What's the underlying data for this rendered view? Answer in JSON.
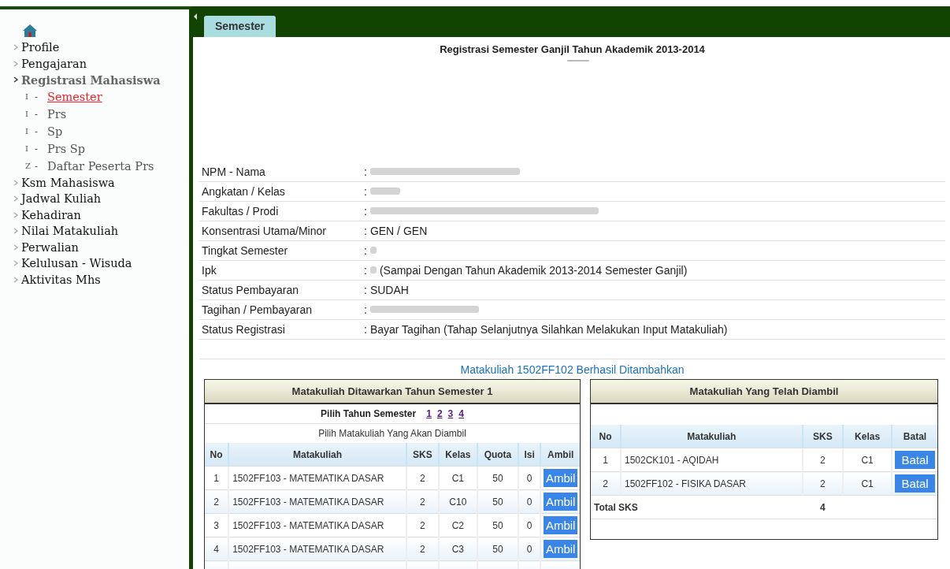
{
  "sidebar": {
    "items": [
      {
        "label": "Profile",
        "expanded": false
      },
      {
        "label": "Pengajaran",
        "expanded": false
      },
      {
        "label": "Registrasi Mahasiswa",
        "expanded": true,
        "children": [
          {
            "prefix": "I",
            "dash": "-",
            "label": "Semester",
            "selected": true
          },
          {
            "prefix": "I",
            "dash": "-",
            "label": "Prs",
            "selected": false
          },
          {
            "prefix": "I",
            "dash": "-",
            "label": "Sp",
            "selected": false
          },
          {
            "prefix": "I",
            "dash": "-",
            "label": "Prs Sp",
            "selected": false
          },
          {
            "prefix": "Z",
            "dash": "-",
            "label": "Daftar Peserta Prs",
            "selected": false
          }
        ]
      },
      {
        "label": "Ksm Mahasiswa",
        "expanded": false
      },
      {
        "label": "Jadwal Kuliah",
        "expanded": false
      },
      {
        "label": "Kehadiran",
        "expanded": false
      },
      {
        "label": "Nilai Matakuliah",
        "expanded": false
      },
      {
        "label": "Perwalian",
        "expanded": false
      },
      {
        "label": "Kelulusan - Wisuda",
        "expanded": false
      },
      {
        "label": "Aktivitas Mhs",
        "expanded": false
      }
    ]
  },
  "tabs": [
    {
      "label": "Semester",
      "selected": true
    }
  ],
  "title": "Registrasi Semester Ganjil Tahun Akademik 2013-2014",
  "info": [
    {
      "label": "NPM - Nama",
      "sep": ":",
      "kind": "redacted"
    },
    {
      "label": "Angkatan / Kelas",
      "sep": ":",
      "kind": "redacted"
    },
    {
      "label": "Fakultas / Prodi",
      "sep": ":",
      "kind": "redacted"
    },
    {
      "label": "Konsentrasi Utama/Minor",
      "sep": ":",
      "kind": "text",
      "value": "GEN / GEN"
    },
    {
      "label": "Tingkat Semester",
      "sep": ":",
      "kind": "redacted"
    },
    {
      "label": "Ipk",
      "sep": ":",
      "kind": "redacted",
      "note": "(Sampai Dengan Tahun Akademik 2013-2014 Semester Ganjil)"
    },
    {
      "label": "Status Pembayaran",
      "sep": ":",
      "kind": "text",
      "value": "SUDAH"
    },
    {
      "label": "Tagihan / Pembayaran",
      "sep": ":",
      "kind": "redacted"
    },
    {
      "label": "Status Registrasi",
      "sep": ":",
      "kind": "text",
      "value": "Bayar Tagihan (Tahap Selanjutnya Silahkan Melakukan Input Matakuliah)"
    }
  ],
  "message": "Matakuliah 1502FF102 Berhasil Ditambahkan",
  "offered": {
    "title": "Matakuliah Ditawarkan Tahun Semester 1",
    "year_label": "Pilih Tahun Semester",
    "years": [
      "1",
      "2",
      "3",
      "4"
    ],
    "subtitle": "Pilih Matakuliah Yang Akan Diambil",
    "columns": [
      "No",
      "Matakuliah",
      "SKS",
      "Kelas",
      "Quota",
      "Isi",
      "Ambil"
    ],
    "rows": [
      {
        "no": "1",
        "course": "1502FF103 - MATEMATIKA DASAR",
        "sks": "2",
        "kelas": "C1",
        "quota": "50",
        "isi": "0",
        "action": "Ambil"
      },
      {
        "no": "2",
        "course": "1502FF103 - MATEMATIKA DASAR",
        "sks": "2",
        "kelas": "C10",
        "quota": "50",
        "isi": "0",
        "action": "Ambil"
      },
      {
        "no": "3",
        "course": "1502FF103 - MATEMATIKA DASAR",
        "sks": "2",
        "kelas": "C2",
        "quota": "50",
        "isi": "0",
        "action": "Ambil"
      },
      {
        "no": "4",
        "course": "1502FF103 - MATEMATIKA DASAR",
        "sks": "2",
        "kelas": "C3",
        "quota": "50",
        "isi": "0",
        "action": "Ambil"
      }
    ]
  },
  "taken": {
    "title": "Matakuliah Yang Telah Diambil",
    "columns": [
      "No",
      "Matakuliah",
      "SKS",
      "Kelas",
      "Batal"
    ],
    "rows": [
      {
        "no": "1",
        "course": "1502CK101 - AQIDAH",
        "sks": "2",
        "kelas": "C1",
        "action": "Batal"
      },
      {
        "no": "2",
        "course": "1502FF102 - FISIKA DASAR",
        "sks": "2",
        "kelas": "C1",
        "action": "Batal"
      }
    ],
    "total_label": "Total SKS",
    "total": "4"
  }
}
